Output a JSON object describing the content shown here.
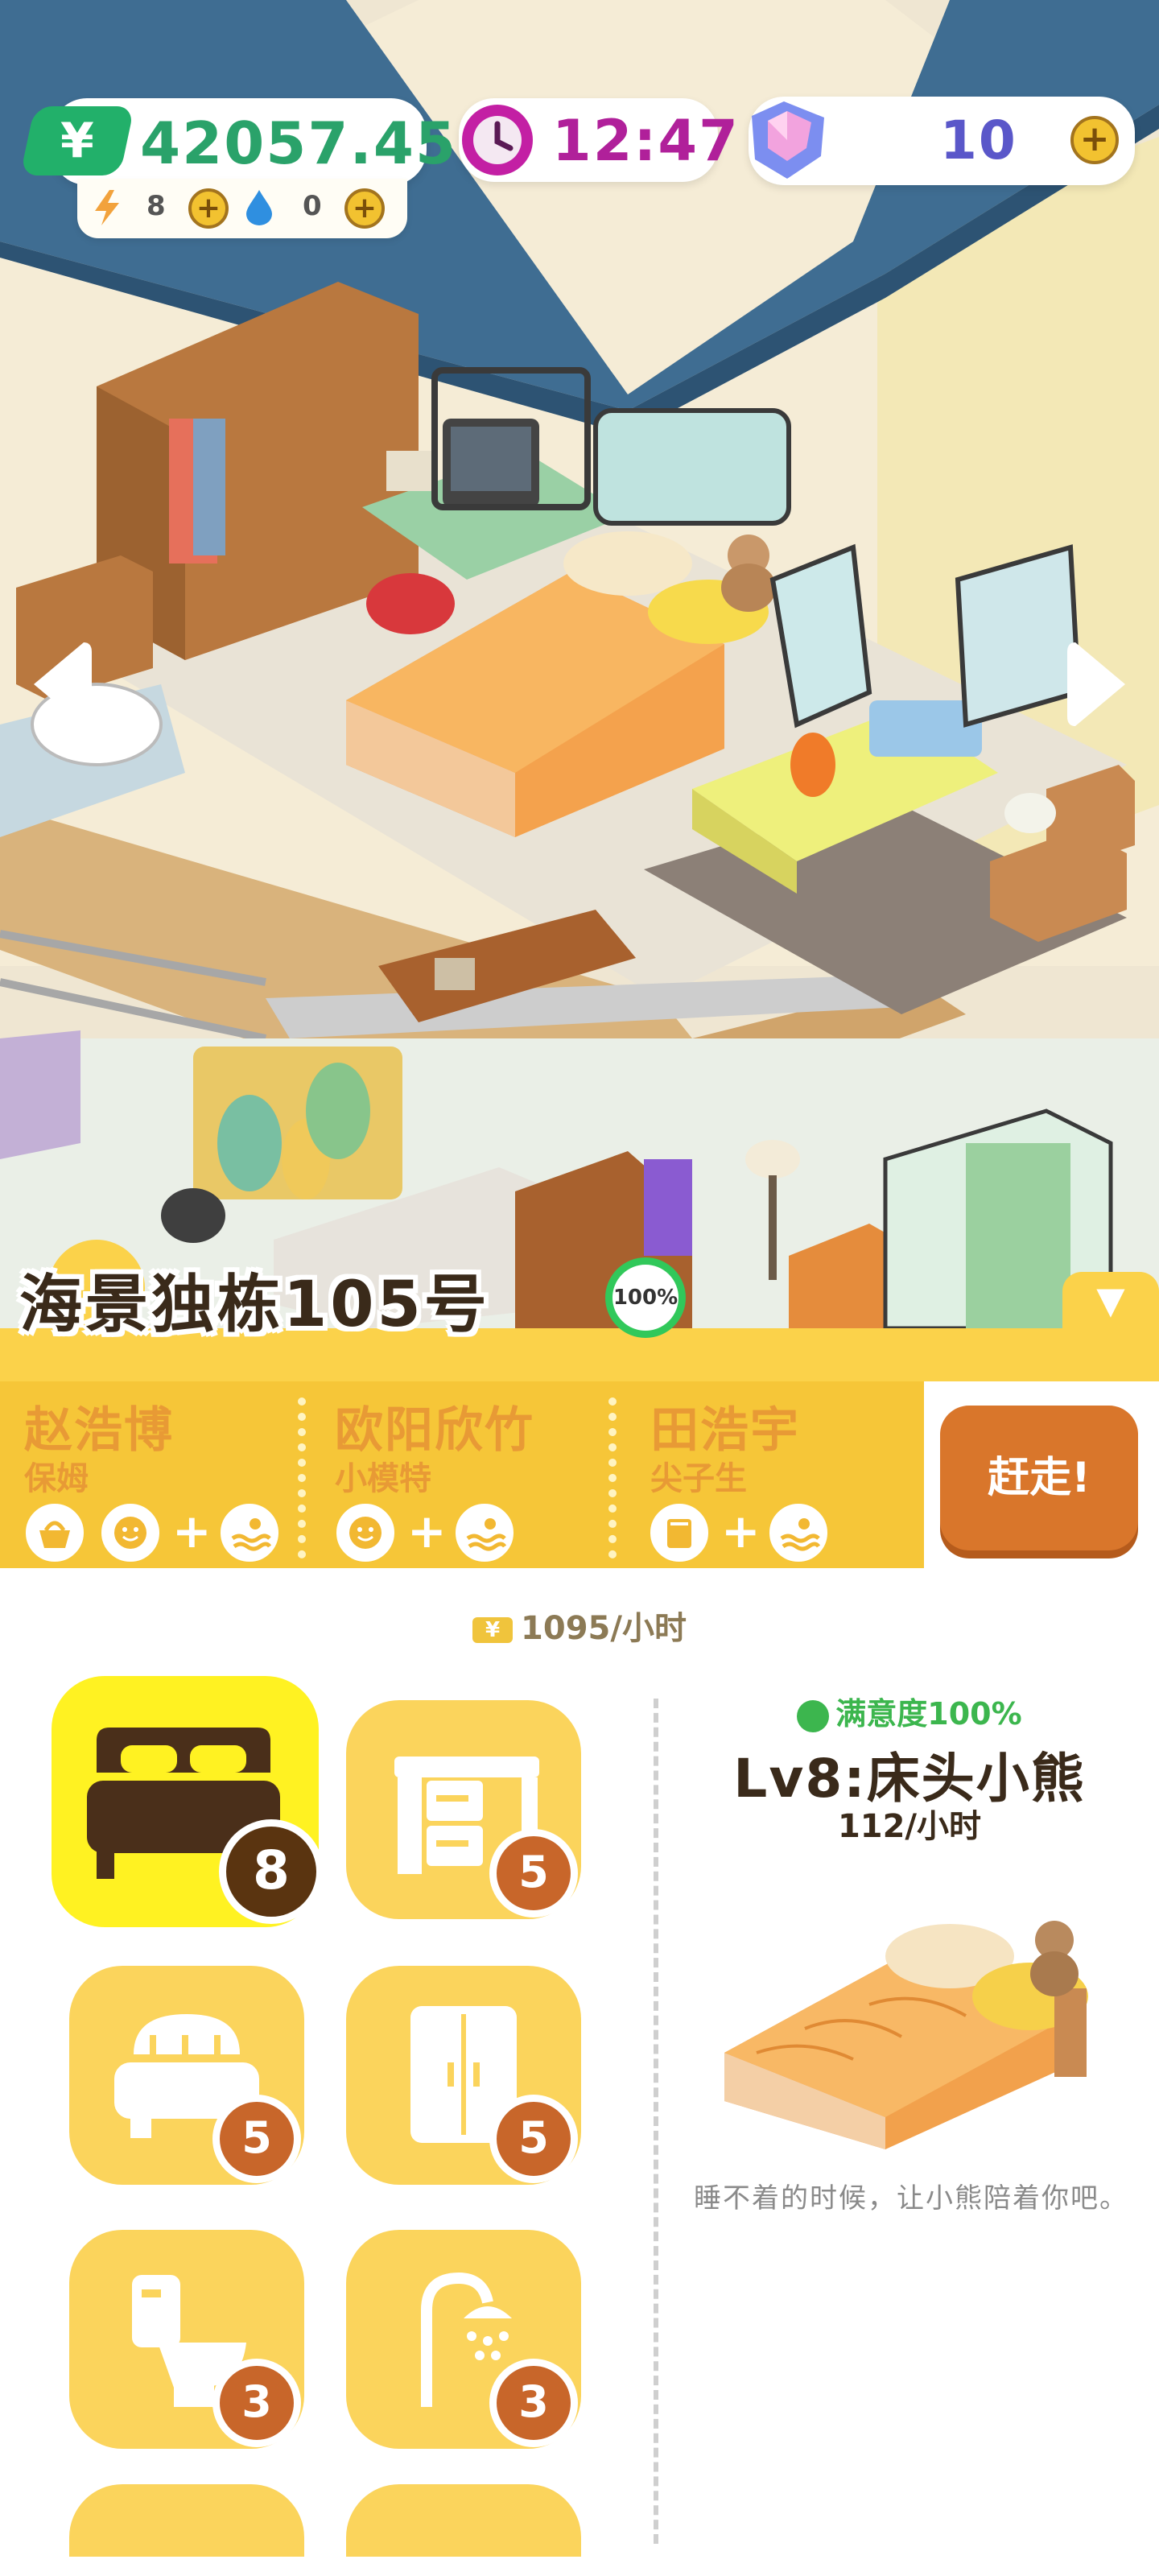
{
  "hud": {
    "money": "42057.45",
    "money_symbol": "¥",
    "energy": "8",
    "water": "0",
    "clock": "12:47",
    "gems": "10",
    "plus_symbol": "+"
  },
  "nav": {
    "prev_symbol": "◀",
    "next_symbol": "▶"
  },
  "house": {
    "title": "海景独栋105号",
    "occupancy_percent": "100%",
    "toggle_symbol": "▼"
  },
  "tenants": [
    {
      "name": "赵浩博",
      "job": "保姆",
      "needs": [
        "basket-icon",
        "smile-face-icon",
        "swim-icon"
      ]
    },
    {
      "name": "欧阳欣竹",
      "job": "小模特",
      "needs": [
        "smile-face-icon",
        "swim-icon"
      ]
    },
    {
      "name": "田浩宇",
      "job": "尖子生",
      "needs": [
        "book-icon",
        "swim-icon"
      ]
    }
  ],
  "evict_label": "赶走!",
  "income_rate": "1095/小时",
  "furniture_categories": [
    {
      "name": "bed",
      "level": "8",
      "selected": true
    },
    {
      "name": "desk",
      "level": "5"
    },
    {
      "name": "bathtub",
      "level": "5"
    },
    {
      "name": "wardrobe",
      "level": "5"
    },
    {
      "name": "toilet",
      "level": "3"
    },
    {
      "name": "shower",
      "level": "3"
    }
  ],
  "detail": {
    "satisfaction": "满意度100%",
    "title": "Lv8:床头小熊",
    "rate": "112/小时",
    "description": "睡不着的时候，让小熊陪着你吧。"
  },
  "colors": {
    "banner": "#fbd24a",
    "tile": "#fbd45c",
    "tile_selected": "#fff222",
    "evict": "#d9762b",
    "badge": "#c8662a",
    "progress_green": "#31c85a"
  }
}
